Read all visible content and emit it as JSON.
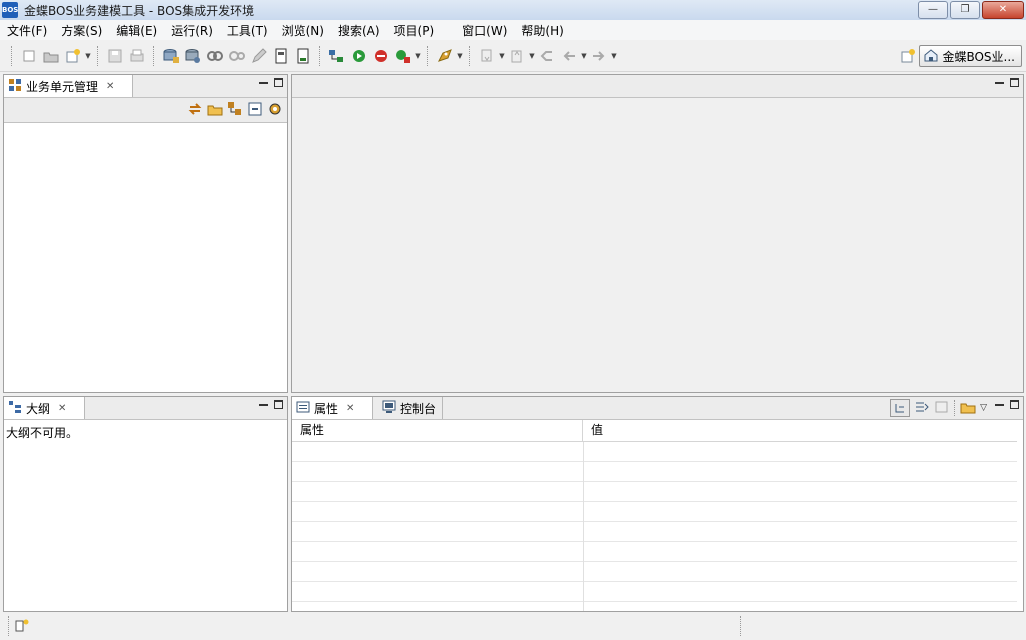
{
  "window": {
    "app_icon_text": "BOS",
    "title": "金蝶BOS业务建模工具  -  BOS集成开发环境",
    "minimize_glyph": "—",
    "restore_glyph": "❐",
    "close_glyph": "✕"
  },
  "menu": [
    "文件(F)",
    "方案(S)",
    "编辑(E)",
    "运行(R)",
    "工具(T)",
    "浏览(N)",
    "搜索(A)",
    "项目(P)",
    "窗口(W)",
    "帮助(H)"
  ],
  "perspective": {
    "label": "金蝶BOS业..."
  },
  "panels": {
    "bu_manager": {
      "tab_label": "业务单元管理",
      "close_glyph": "✕"
    },
    "outline": {
      "tab_label": "大纲",
      "close_glyph": "✕",
      "message": "大纲不可用。"
    },
    "properties": {
      "tab_label": "属性",
      "close_glyph": "✕",
      "console_tab_label": "控制台",
      "columns": [
        "属性",
        "值"
      ]
    }
  },
  "colors": {
    "accent": "#1f5fb8",
    "panel_border": "#a0a0a0",
    "background": "#f0f0f0"
  }
}
